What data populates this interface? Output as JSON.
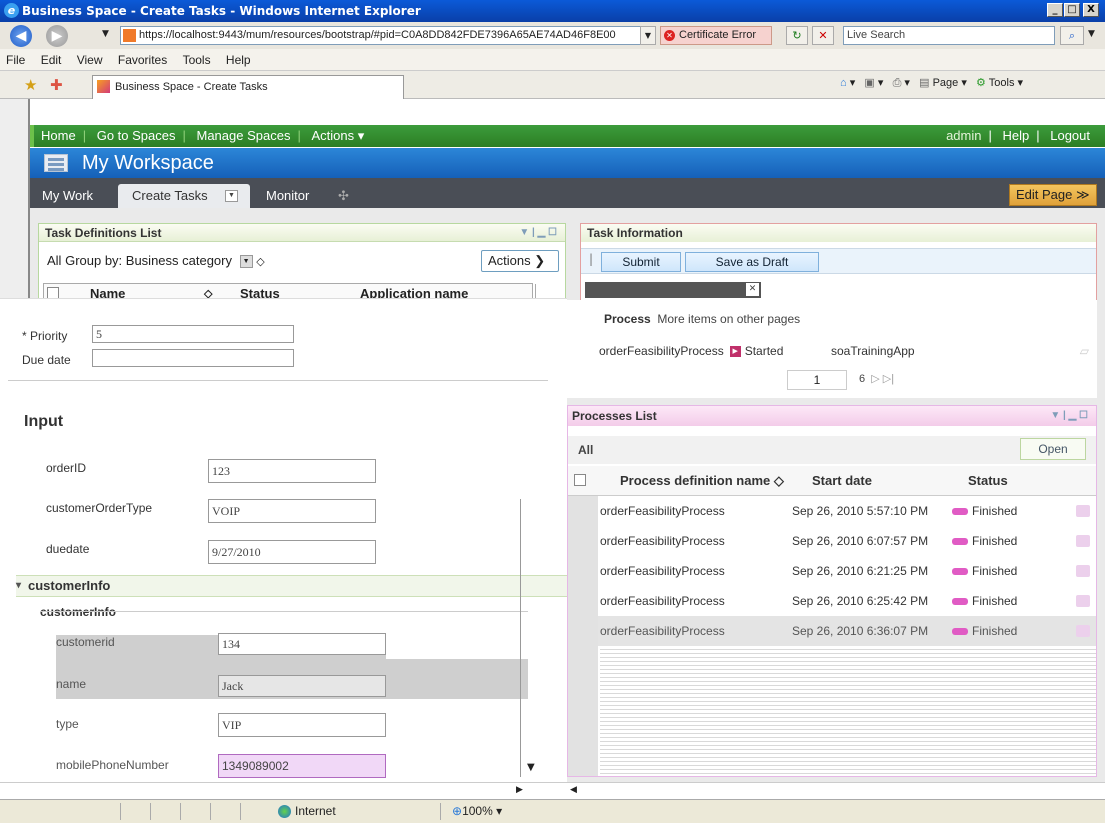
{
  "window": {
    "title": "Business Space - Create Tasks - Windows Internet Explorer",
    "url": "https://localhost:9443/mum/resources/bootstrap/#pid=C0A8DD842FDE7396A65AE74AD46F8E00",
    "cert_error": "Certificate Error",
    "search_placeholder": "Live Search",
    "minimize": "_",
    "maximize": "□",
    "close": "X"
  },
  "menu": [
    "File",
    "Edit",
    "View",
    "Favorites",
    "Tools",
    "Help"
  ],
  "ie_tab": {
    "label": "Business Space - Create Tasks"
  },
  "command_bar": {
    "page": "Page",
    "tools": "Tools"
  },
  "app_nav": {
    "items": [
      "Home",
      "Go to Spaces",
      "Manage Spaces",
      "Actions ▾"
    ],
    "right": [
      "admin",
      "Help",
      "Logout"
    ]
  },
  "workspace": {
    "title": "My Workspace"
  },
  "space_tabs": {
    "my_work": "My Work",
    "create_tasks": "Create Tasks",
    "monitor": "Monitor",
    "add": "✣",
    "edit_page": "Edit Page ≫"
  },
  "task_definitions": {
    "title": "Task Definitions List",
    "all": "All",
    "group_by": "Group by: Business category",
    "actions": "Actions ❯",
    "columns": [
      "Name",
      "Status",
      "Application name"
    ]
  },
  "form": {
    "priority_label": "* Priority",
    "priority_value": "5",
    "due_date_label": "Due date",
    "due_date_value": "",
    "input_heading": "Input",
    "fields": [
      {
        "label": "orderID",
        "value": "123"
      },
      {
        "label": "customerOrderType",
        "value": "VOIP"
      },
      {
        "label": "duedate",
        "value": "9/27/2010"
      }
    ],
    "customer_info_heading": "customerInfo",
    "customer_info_sub": "customerInfo",
    "customer_fields": [
      {
        "label": "customerid",
        "value": "134"
      },
      {
        "label": "name",
        "value": "Jack"
      },
      {
        "label": "type",
        "value": "VIP"
      },
      {
        "label": "mobilePhoneNumber",
        "value": "1349089002"
      }
    ]
  },
  "task_information": {
    "title": "Task Information",
    "submit": "Submit",
    "save_draft": "Save as Draft",
    "process_label": "Process",
    "process_note": "More items on other pages",
    "process_row": {
      "name": "orderFeasibilityProcess",
      "state": "Started",
      "app": "soaTrainingApp"
    },
    "page_current": "1",
    "page_total": "6"
  },
  "processes_list": {
    "title": "Processes List",
    "all": "All",
    "open": "Open",
    "columns": [
      "Process definition name ◇",
      "Start date",
      "Status"
    ],
    "rows": [
      {
        "name": "orderFeasibilityProcess",
        "date": "Sep 26, 2010 5:57:10 PM",
        "status": "Finished"
      },
      {
        "name": "orderFeasibilityProcess",
        "date": "Sep 26, 2010 6:07:57 PM",
        "status": "Finished"
      },
      {
        "name": "orderFeasibilityProcess",
        "date": "Sep 26, 2010 6:21:25 PM",
        "status": "Finished"
      },
      {
        "name": "orderFeasibilityProcess",
        "date": "Sep 26, 2010 6:25:42 PM",
        "status": "Finished"
      },
      {
        "name": "orderFeasibilityProcess",
        "date": "Sep 26, 2010 6:36:07 PM",
        "status": "Finished"
      }
    ]
  },
  "status_bar": {
    "zone": "Internet",
    "zoom": "100%"
  }
}
